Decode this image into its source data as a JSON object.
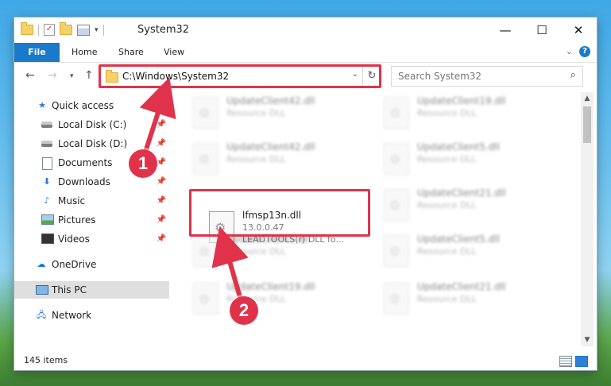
{
  "window": {
    "title": "System32"
  },
  "titlebar": {
    "minimize": "—",
    "maximize": "☐",
    "close": "✕"
  },
  "ribbon": {
    "tabs": [
      "File",
      "Home",
      "Share",
      "View"
    ],
    "help": "?"
  },
  "address": {
    "path": "C:\\Windows\\System32"
  },
  "search": {
    "placeholder": "Search System32"
  },
  "sidebar": {
    "items": [
      {
        "label": "Quick access"
      },
      {
        "label": "Local Disk (C:)"
      },
      {
        "label": "Local Disk (D:)"
      },
      {
        "label": "Documents"
      },
      {
        "label": "Downloads"
      },
      {
        "label": "Music"
      },
      {
        "label": "Pictures"
      },
      {
        "label": "Videos"
      },
      {
        "label": "OneDrive"
      },
      {
        "label": "This PC"
      },
      {
        "label": "Network"
      }
    ]
  },
  "files": [
    {
      "name": "UpdateClient42.dll",
      "type": "Resource DLL"
    },
    {
      "name": "UpdateClient19.dll",
      "type": "Resource DLL"
    },
    {
      "name": "UpdateClient42.dll",
      "type": "Resource DLL"
    },
    {
      "name": "UpdateClient5.dll",
      "type": "Resource DLL"
    },
    {
      "name": "lfmsp13n.dll",
      "version": "13.0.0.47",
      "description": "LEADTOOLS(r) DLL fo..."
    },
    {
      "name": "UpdateClient21.dll",
      "type": "Resource DLL"
    },
    {
      "name": "UpdateClient5.dll",
      "type": "Resource DLL"
    },
    {
      "name": "UpdateClient5.dll",
      "type": "Resource DLL"
    },
    {
      "name": "UpdateClient19.dll",
      "type": "Resource DLL"
    },
    {
      "name": "UpdateClient21.dll",
      "type": "Resource DLL"
    }
  ],
  "status": {
    "count": "145 items"
  },
  "callouts": {
    "one": "1",
    "two": "2"
  },
  "colors": {
    "accent": "#1979ca",
    "highlight": "#e0334b"
  }
}
